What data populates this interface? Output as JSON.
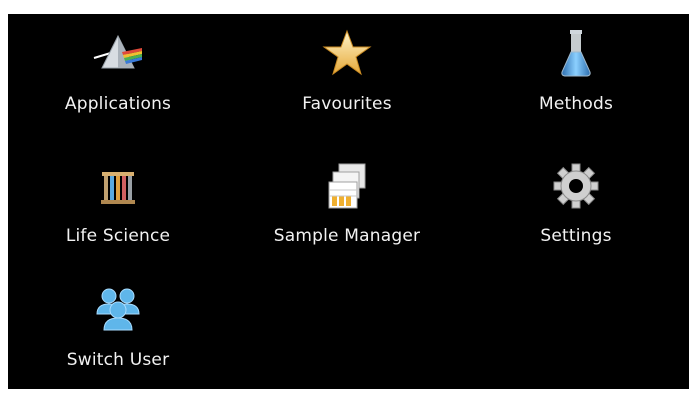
{
  "menu": {
    "items": [
      {
        "label": "Applications",
        "icon": "prism-icon"
      },
      {
        "label": "Favourites",
        "icon": "star-icon"
      },
      {
        "label": "Methods",
        "icon": "flask-icon"
      },
      {
        "label": "Life Science",
        "icon": "test-tubes-icon"
      },
      {
        "label": "Sample Manager",
        "icon": "sample-rack-icon"
      },
      {
        "label": "Settings",
        "icon": "gear-icon"
      },
      {
        "label": "Switch User",
        "icon": "users-icon"
      }
    ]
  },
  "colors": {
    "background": "#000000",
    "text": "#f2f2f2",
    "star": "#f3c56a",
    "flask": "#5aa8e0",
    "users": "#5fb6ea",
    "gear": "#cfcfcf"
  }
}
